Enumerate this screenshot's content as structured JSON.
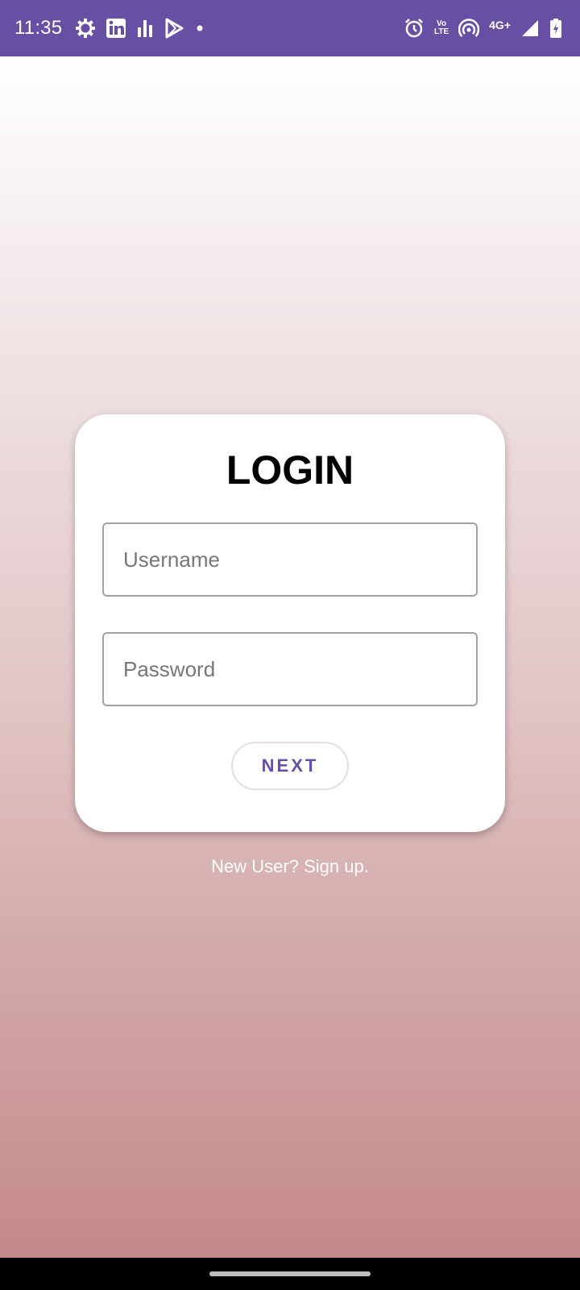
{
  "status_bar": {
    "time": "11:35",
    "left_icons": [
      "settings-icon",
      "linkedin-icon",
      "bar-chart-icon",
      "play-store-icon",
      "dot-icon"
    ],
    "right_icons": [
      "alarm-icon",
      "volte-icon",
      "hotspot-icon",
      "network-4g-icon",
      "signal-icon",
      "battery-icon"
    ],
    "volte_top": "Vo",
    "volte_bottom": "LTE",
    "network_label": "4G+",
    "background_color": "#6750a4"
  },
  "login_card": {
    "title": "LOGIN",
    "username_placeholder": "Username",
    "password_placeholder": "Password",
    "next_label": "NEXT",
    "accent_color": "#6750a4"
  },
  "signup_text": "New User? Sign up."
}
